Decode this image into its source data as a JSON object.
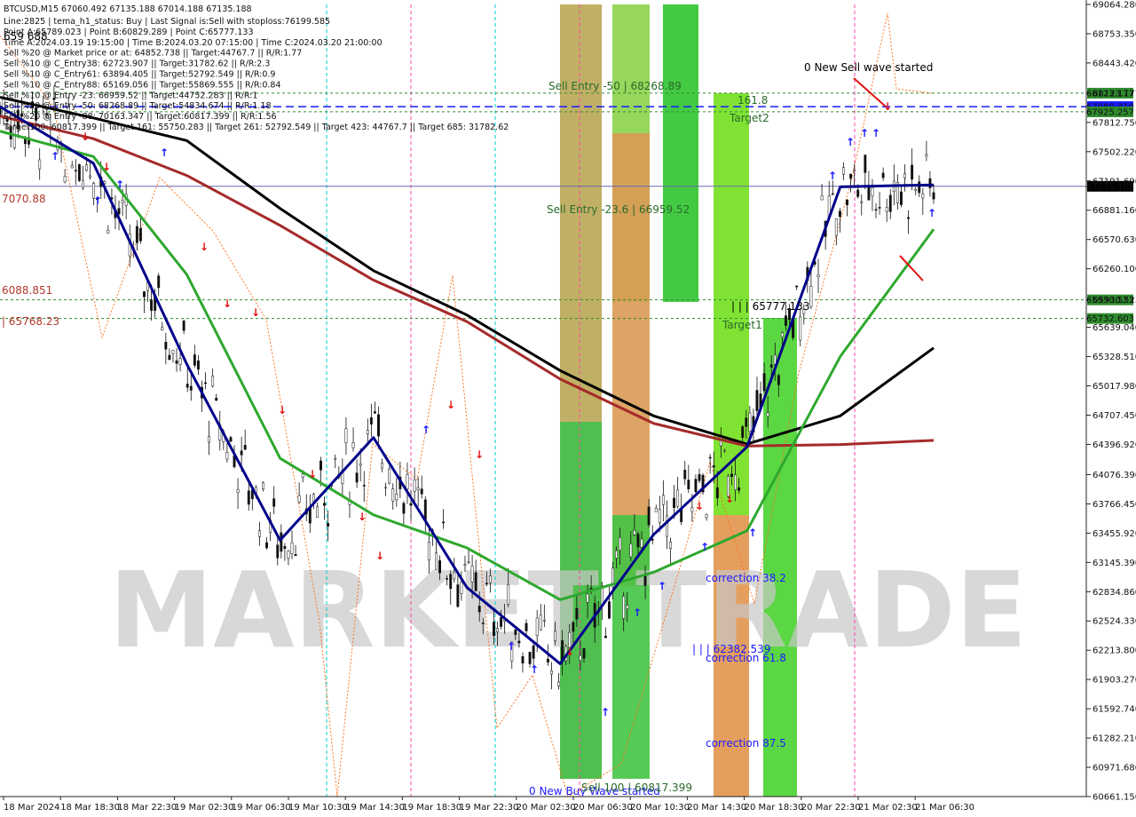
{
  "chart_data": {
    "type": "line",
    "symbol": "BTCUSD,M15",
    "ohlc_header": "BTCUSD,M15  67060.492 67135.188 67014.188 67135.188",
    "ylim": [
      60661.15,
      69064.28
    ],
    "y_ticks": [
      "69064.280",
      "68753.350",
      "68443.420",
      "68123.177",
      "67812.750",
      "67502.220",
      "67191.690",
      "66881.160",
      "66570.630",
      "66260.100",
      "65930.523",
      "65639.040",
      "65328.510",
      "65017.980",
      "64707.450",
      "64396.920",
      "64076.390",
      "63766.450",
      "63455.920",
      "63145.390",
      "62834.860",
      "62524.330",
      "62213.800",
      "61903.270",
      "61592.740",
      "61282.210",
      "60971.680",
      "60661.150"
    ],
    "x_ticks": [
      "18 Mar 2024",
      "18 Mar 18:30",
      "18 Mar 22:30",
      "19 Mar 02:30",
      "19 Mar 06:30",
      "19 Mar 10:30",
      "19 Mar 14:30",
      "19 Mar 18:30",
      "19 Mar 22:30",
      "20 Mar 02:30",
      "20 Mar 06:30",
      "20 Mar 10:30",
      "20 Mar 14:30",
      "20 Mar 18:30",
      "20 Mar 22:30",
      "21 Mar 02:30",
      "21 Mar 06:30"
    ],
    "price_tags": [
      {
        "text": "68123.177",
        "value": 68123.177,
        "color": "#2e8b2e"
      },
      {
        "text": "67980.319",
        "value": 67980.319,
        "color": "#1a1aff"
      },
      {
        "text": "67925.257",
        "value": 67925.257,
        "color": "#2e8b2e"
      },
      {
        "text": "67135.188",
        "value": 67135.188,
        "color": "#000000"
      },
      {
        "text": "65930.523",
        "value": 65930.523,
        "color": "#2e8b2e"
      },
      {
        "text": "65732.603",
        "value": 65732.603,
        "color": "#2e8b2e"
      }
    ],
    "info_lines": [
      "Line:2825 | tema_h1_status: Buy | Last Signal is:Sell with stoploss:76199.585",
      "Point A:65789.023 | Point B:60829.289 | Point C:65777.133",
      "Time A:2024.03.19 19:15:00 | Time B:2024.03.20 07:15:00 | Time C:2024.03.20 21:00:00",
      "Sell %20 @ Market price or at: 64852.738 || Target:44767.7 || R/R:1.77",
      "Sell %10 @ C_Entry38: 62723.907 || Target:31782.62 || R/R:2.3",
      "Sell %10 @ C_Entry61: 63894.405 || Target:52792.549 || R/R:0.9",
      "Sell %10 @ C_Entry88: 65169.056 || Target:55869.555 || R/R:0.84",
      "Sell %10 @ Entry -23: 66959.52 || Target:44752.283 || R/R:1",
      "Sell %20 @ Entry -50: 68268.89 || Target:54834.674 || R/R:1.18",
      "Sell %20 @ Entry -88: 70163.347 || Target:60817.399 || R/R:1.56",
      "Target100: 60817.399 || Target 161: 55750.283 || Target 261: 52792.549 || Target 423: 44767.7 || Target 685: 31782.62"
    ],
    "annotations": [
      {
        "text": "Sell Entry -50 | 68268.89",
        "color": "#2a6a2a"
      },
      {
        "text": "Sell Entry -23.6 | 66959.52",
        "color": "#2a6a2a"
      },
      {
        "text": "0 New Sell wave started",
        "color": "#000000"
      },
      {
        "text": "161.8",
        "color": "#2a6a2a"
      },
      {
        "text": "Target2",
        "color": "#2a6a2a"
      },
      {
        "text": "| | | 65777.133",
        "color": "#000000"
      },
      {
        "text": "Target1",
        "color": "#2a6a2a"
      },
      {
        "text": "correction 38.2",
        "color": "#1a1aff"
      },
      {
        "text": "| | | 62382.539",
        "color": "#1a1aff"
      },
      {
        "text": "correction 61.8",
        "color": "#1a1aff"
      },
      {
        "text": "correction 87.5",
        "color": "#1a1aff"
      },
      {
        "text": "0 New Buy Wave started",
        "color": "#1a1aff"
      },
      {
        "text": "Sell 100 | 60817.399",
        "color": "#2a6a2a"
      },
      {
        "text": "7070.88",
        "color": "#b03a2e"
      },
      {
        "text": "6088.851",
        "color": "#b03a2e"
      },
      {
        "text": "| 65768.23",
        "color": "#b03a2e"
      },
      {
        "text": "659 688",
        "color": "#000000"
      }
    ],
    "watermark": "MARKET TRADE",
    "series": [
      {
        "name": "",
        "color": "#000000",
        "x": [
          0,
          0.1,
          0.2,
          0.3,
          0.4,
          0.5,
          0.6,
          0.7,
          0.8,
          0.9,
          1
        ],
        "y": [
          68080,
          67860,
          67620,
          66900,
          66240,
          65770,
          65180,
          64700,
          64400,
          64700,
          65420
        ]
      },
      {
        "name": "",
        "color": "#a52a2a",
        "x": [
          0,
          0.1,
          0.2,
          0.3,
          0.4,
          0.5,
          0.6,
          0.7,
          0.8,
          0.9,
          1
        ],
        "y": [
          67880,
          67640,
          67250,
          66720,
          66140,
          65700,
          65090,
          64620,
          64380,
          64395,
          64440
        ]
      },
      {
        "name": "",
        "color": "#2ea82e",
        "x": [
          0,
          0.1,
          0.2,
          0.3,
          0.4,
          0.5,
          0.6,
          0.7,
          0.8,
          0.9,
          1
        ],
        "y": [
          67720,
          67450,
          66200,
          64250,
          63650,
          63300,
          62750,
          63040,
          63480,
          65330,
          66680
        ]
      },
      {
        "name": "",
        "color": "#00008b",
        "x": [
          0,
          0.1,
          0.2,
          0.3,
          0.4,
          0.5,
          0.6,
          0.7,
          0.8,
          0.9,
          1
        ],
        "y": [
          67980,
          67380,
          65250,
          63380,
          64470,
          62880,
          62070,
          63440,
          64370,
          67130,
          67150
        ]
      }
    ]
  }
}
